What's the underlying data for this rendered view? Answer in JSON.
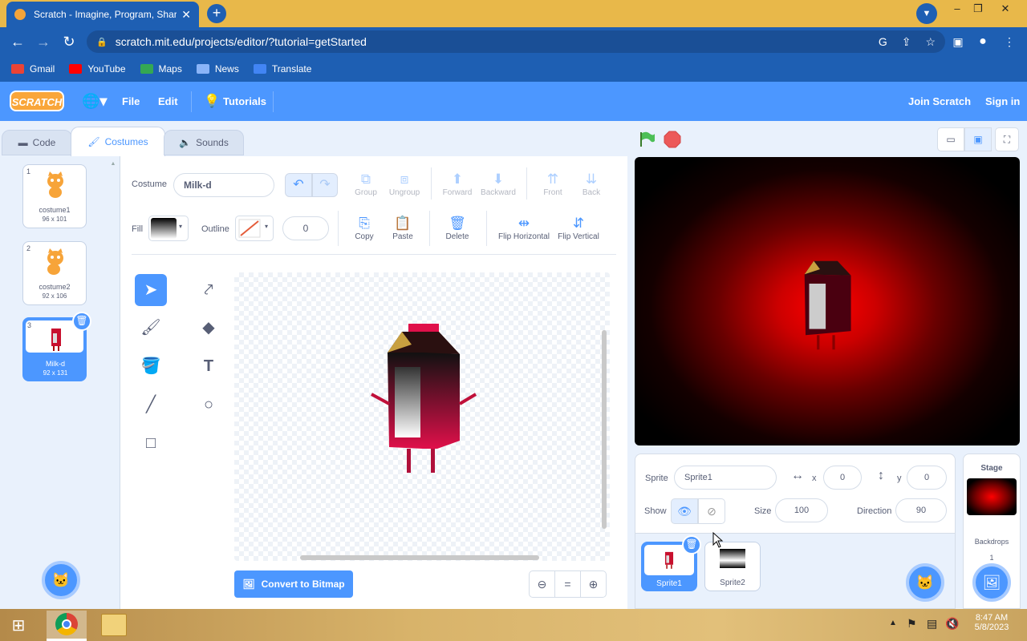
{
  "browser": {
    "tab_title": "Scratch - Imagine, Program, Shar",
    "url": "scratch.mit.edu/projects/editor/?tutorial=getStarted",
    "bookmarks": [
      "Gmail",
      "YouTube",
      "Maps",
      "News",
      "Translate"
    ]
  },
  "menu": {
    "logo": "SCRATCH",
    "file": "File",
    "edit": "Edit",
    "tutorials": "Tutorials",
    "join": "Join Scratch",
    "signin": "Sign in"
  },
  "tabs": {
    "code": "Code",
    "costumes": "Costumes",
    "sounds": "Sounds"
  },
  "costumes": [
    {
      "num": "1",
      "name": "costume1",
      "size": "96 x 101"
    },
    {
      "num": "2",
      "name": "costume2",
      "size": "92 x 106"
    },
    {
      "num": "3",
      "name": "Milk-d",
      "size": "92 x 131"
    }
  ],
  "paint": {
    "costume_label": "Costume",
    "costume_name": "Milk-d",
    "fill_label": "Fill",
    "outline_label": "Outline",
    "outline_width": "0",
    "group": "Group",
    "ungroup": "Ungroup",
    "forward": "Forward",
    "backward": "Backward",
    "front": "Front",
    "back": "Back",
    "copy": "Copy",
    "paste": "Paste",
    "delete": "Delete",
    "flip_h": "Flip Horizontal",
    "flip_v": "Flip Vertical",
    "convert": "Convert to Bitmap"
  },
  "sprite": {
    "label": "Sprite",
    "name": "Sprite1",
    "x_label": "x",
    "x": "0",
    "y_label": "y",
    "y": "0",
    "show_label": "Show",
    "size_label": "Size",
    "size": "100",
    "direction_label": "Direction",
    "direction": "90"
  },
  "sprites": [
    "Sprite1",
    "Sprite2"
  ],
  "stage_panel": {
    "title": "Stage",
    "backdrops_label": "Backdrops",
    "backdrops_count": "1"
  },
  "taskbar": {
    "time": "8:47 AM",
    "date": "5/8/2023"
  }
}
